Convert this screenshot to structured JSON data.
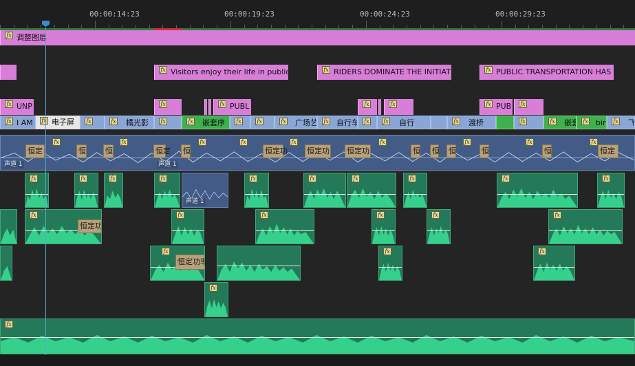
{
  "ruler": {
    "timecodes": [
      "00:00:14:23",
      "00:00:19:23",
      "00:00:24:23",
      "00:00:29:23"
    ],
    "work_area_color": "#2f7a3e",
    "render_warning_color": "#c83232"
  },
  "playhead": {
    "timecode_visible": "",
    "color": "#3d8ac8"
  },
  "tracks": {
    "adjustment_layer": {
      "label": "调整图层",
      "color": "#d87ed8"
    },
    "v_titles": [
      "Visitors enjoy their life in public",
      "RIDERS DOMINATE THE INITIATI",
      "PUBLIC TRANSPORTATION HAS B"
    ],
    "v_upper": [
      "UNP",
      "PUBL",
      "PUB"
    ],
    "v_clips": [
      "I AM",
      "电子屏",
      "橘光影",
      "嵌套序",
      "广场艺",
      "自行车",
      "自行",
      "渡桥",
      "嵌套",
      "bird",
      "飞"
    ],
    "main_audio": {
      "fixed_effect_labels": [
        "恒定",
        "恒",
        "恒",
        "恒定",
        "恒",
        "恒定功",
        "恒定功",
        "恒定功",
        "恒",
        "恒",
        "恒",
        "恒",
        "恒",
        "恒定"
      ],
      "channel_label": "声道 1"
    },
    "audio_effect_labels": [
      "恒定功",
      "恒定功率"
    ],
    "audio_channel_label": "声道 1"
  },
  "colors": {
    "audio_clip": "#247a58",
    "audio_waveform": "#36d08d",
    "video_clip": "#8aa6d6",
    "adjustment_clip": "#d87ed8",
    "nested_clip": "#3fb04e",
    "timeline_bg": "#232323"
  },
  "icons": [
    "fx-badge-icon",
    "playhead-icon"
  ]
}
